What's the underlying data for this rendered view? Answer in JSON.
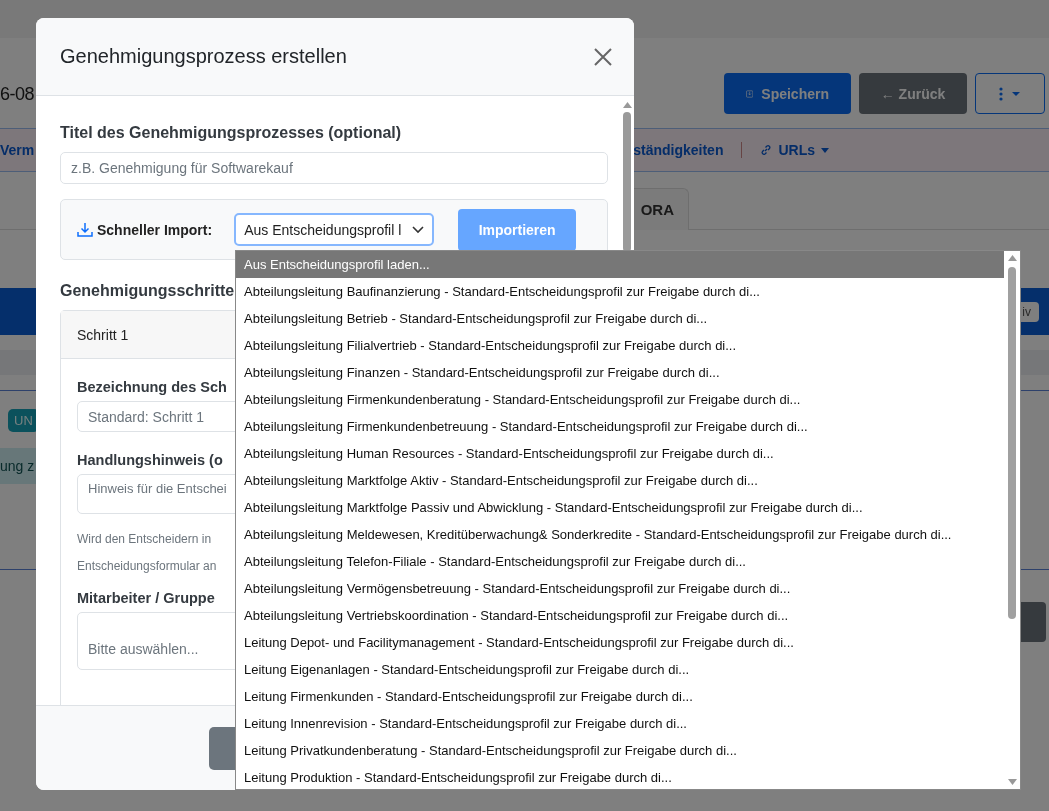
{
  "page": {
    "record_id": "6-08",
    "actions": [
      {
        "kind": "primary",
        "label": "Speichern"
      },
      {
        "kind": "secondary",
        "label": "← Zurück"
      },
      {
        "kind": "menu"
      }
    ],
    "nav_links": [
      {
        "label": "Verm",
        "dropdown": false
      },
      {
        "label": "ständigkeiten",
        "dropdown": false
      },
      {
        "label": "URLs",
        "dropdown": true
      }
    ],
    "tabs": [
      {
        "label": "ORA",
        "selected": false
      }
    ],
    "bar_badge": "iv",
    "status_badge": "UN",
    "notice": "ung z"
  },
  "modal": {
    "title": "Genehmigungsprozess erstellen",
    "title_field": {
      "label": "Titel des Genehmigungsprozesses (optional)",
      "placeholder": "z.B. Genehmigung für Softwarekauf"
    },
    "import": {
      "label": "Schneller Import:",
      "select_value": "Aus Entscheidungsprofil l",
      "button": "Importieren",
      "button_disabled": true
    },
    "steps_heading": "Genehmigungsschritte",
    "steps": [
      {
        "title": "Schritt 1",
        "name_label": "Bezeichnung des Sch",
        "name_placeholder": "Standard: Schritt 1",
        "hint_label": "Handlungshinweis (o",
        "hint_placeholder": "Hinweis für die Entschei",
        "hint_help": "Wird den Entscheidern in Entscheidungsformular an",
        "members_label": "Mitarbeiter / Gruppe",
        "members_placeholder": "Bitte auswählen..."
      }
    ]
  },
  "dropdown": {
    "options": [
      {
        "label": "Aus Entscheidungsprofil laden...",
        "selected": true
      },
      {
        "label": "Abteilungsleitung Baufinanzierung - Standard-Entscheidungsprofil zur Freigabe durch di...",
        "selected": false
      },
      {
        "label": "Abteilungsleitung Betrieb - Standard-Entscheidungsprofil zur Freigabe durch di...",
        "selected": false
      },
      {
        "label": "Abteilungsleitung Filialvertrieb - Standard-Entscheidungsprofil zur Freigabe durch di...",
        "selected": false
      },
      {
        "label": "Abteilungsleitung Finanzen - Standard-Entscheidungsprofil zur Freigabe durch di...",
        "selected": false
      },
      {
        "label": "Abteilungsleitung Firmenkundenberatung - Standard-Entscheidungsprofil zur Freigabe durch di...",
        "selected": false
      },
      {
        "label": "Abteilungsleitung Firmenkundenbetreuung - Standard-Entscheidungsprofil zur Freigabe durch di...",
        "selected": false
      },
      {
        "label": "Abteilungsleitung Human Resources - Standard-Entscheidungsprofil zur Freigabe durch di...",
        "selected": false
      },
      {
        "label": "Abteilungsleitung Marktfolge Aktiv - Standard-Entscheidungsprofil zur Freigabe durch di...",
        "selected": false
      },
      {
        "label": "Abteilungsleitung Marktfolge Passiv und Abwicklung - Standard-Entscheidungsprofil zur Freigabe durch di...",
        "selected": false
      },
      {
        "label": "Abteilungsleitung Meldewesen, Kreditüberwachung& Sonderkredite - Standard-Entscheidungsprofil zur Freigabe durch di...",
        "selected": false
      },
      {
        "label": "Abteilungsleitung Telefon-Filiale - Standard-Entscheidungsprofil zur Freigabe durch di...",
        "selected": false
      },
      {
        "label": "Abteilungsleitung Vermögensbetreuung - Standard-Entscheidungsprofil zur Freigabe durch di...",
        "selected": false
      },
      {
        "label": "Abteilungsleitung Vertriebskoordination - Standard-Entscheidungsprofil zur Freigabe durch di...",
        "selected": false
      },
      {
        "label": "Leitung Depot- und Facilitymanagement - Standard-Entscheidungsprofil zur Freigabe durch di...",
        "selected": false
      },
      {
        "label": "Leitung Eigenanlagen - Standard-Entscheidungsprofil zur Freigabe durch di...",
        "selected": false
      },
      {
        "label": "Leitung Firmenkunden - Standard-Entscheidungsprofil zur Freigabe durch di...",
        "selected": false
      },
      {
        "label": "Leitung Innenrevision - Standard-Entscheidungsprofil zur Freigabe durch di...",
        "selected": false
      },
      {
        "label": "Leitung Privatkundenberatung - Standard-Entscheidungsprofil zur Freigabe durch di...",
        "selected": false
      },
      {
        "label": "Leitung Produktion - Standard-Entscheidungsprofil zur Freigabe durch di...",
        "selected": false
      }
    ]
  }
}
